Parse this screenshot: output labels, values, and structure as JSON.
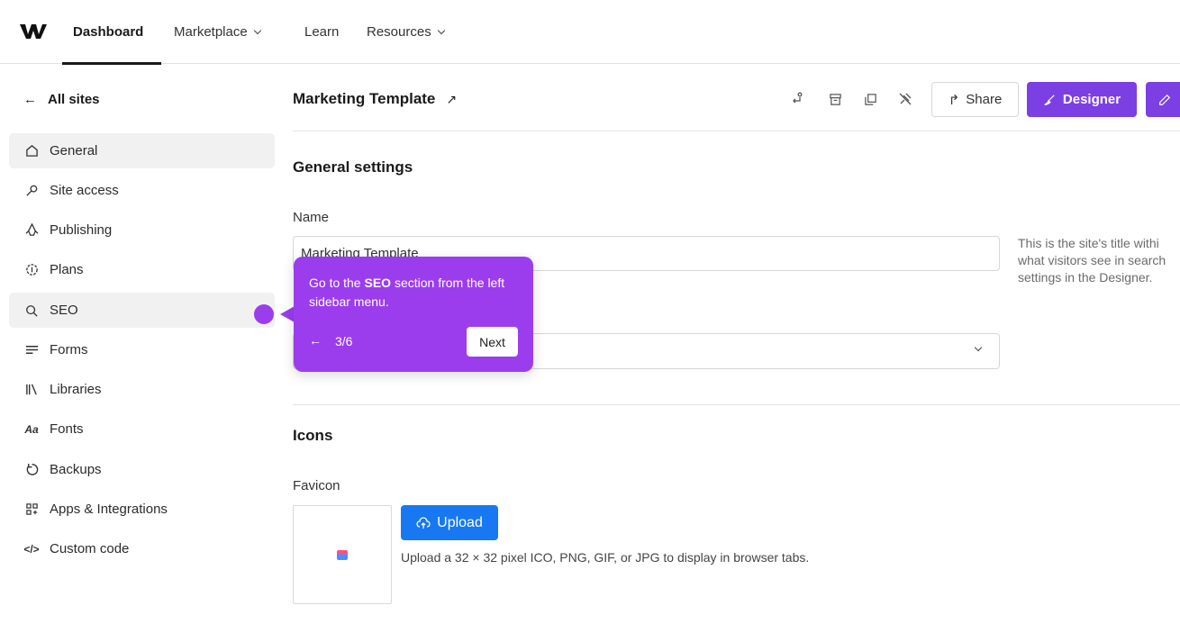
{
  "topnav": {
    "items": [
      {
        "label": "Dashboard",
        "active": true
      },
      {
        "label": "Marketplace",
        "dropdown": true
      },
      {
        "label": "Learn"
      },
      {
        "label": "Resources",
        "dropdown": true
      }
    ]
  },
  "sidebar": {
    "back_label": "All sites",
    "items": [
      {
        "label": "General",
        "icon": "home-icon",
        "selected": true
      },
      {
        "label": "Site access",
        "icon": "key-icon"
      },
      {
        "label": "Publishing",
        "icon": "rocket-icon"
      },
      {
        "label": "Plans",
        "icon": "plans-icon"
      },
      {
        "label": "SEO",
        "icon": "search-icon"
      },
      {
        "label": "Forms",
        "icon": "forms-icon"
      },
      {
        "label": "Libraries",
        "icon": "libraries-icon"
      },
      {
        "label": "Fonts",
        "icon": "fonts-icon"
      },
      {
        "label": "Backups",
        "icon": "backup-icon"
      },
      {
        "label": "Apps & Integrations",
        "icon": "apps-icon"
      },
      {
        "label": "Custom code",
        "icon": "code-icon"
      }
    ]
  },
  "header": {
    "title": "Marketing Template",
    "share_label": "Share",
    "designer_label": "Designer"
  },
  "general": {
    "section_title": "General settings",
    "name_label": "Name",
    "name_value": "Marketing Template",
    "help_text_1": "This is the site's title withi",
    "help_text_2": "what visitors see in search",
    "help_text_3": "settings in the Designer."
  },
  "icons": {
    "section_title": "Icons",
    "favicon_label": "Favicon",
    "upload_label": "Upload",
    "upload_help": "Upload a 32 × 32 pixel ICO, PNG, GIF, or JPG to display in browser tabs."
  },
  "tour": {
    "text_before": "Go to the ",
    "text_bold": "SEO",
    "text_after": " section from the left sidebar menu.",
    "step": "3/6",
    "next_label": "Next"
  },
  "colors": {
    "accent_purple": "#7b3fe4",
    "tour_purple": "#9b3ded",
    "upload_blue": "#1778f2"
  }
}
